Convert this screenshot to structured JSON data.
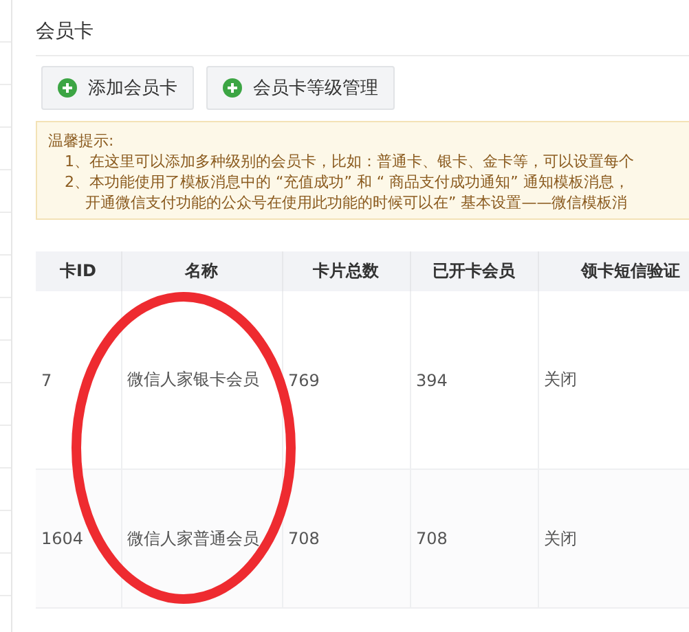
{
  "page": {
    "title": "会员卡"
  },
  "buttons": [
    {
      "label": "添加会员卡"
    },
    {
      "label": "会员卡等级管理"
    }
  ],
  "notice": {
    "heading": "温馨提示:",
    "lines": [
      "1、在这里可以添加多种级别的会员卡，比如：普通卡、银卡、金卡等，可以设置每个",
      "2、本功能使用了模板消息中的 “充值成功” 和 “ 商品支付成功通知” 通知模板消息，",
      "开通微信支付功能的公众号在使用此功能的时候可以在” 基本设置——微信模板消"
    ]
  },
  "table": {
    "columns": [
      "卡ID",
      "名称",
      "卡片总数",
      "已开卡会员",
      "领卡短信验证"
    ],
    "rows": [
      [
        "7",
        "微信人家银卡会员",
        "769",
        "394",
        "关闭"
      ],
      [
        "1604",
        "微信人家普通会员",
        "708",
        "708",
        "关闭"
      ]
    ]
  }
}
